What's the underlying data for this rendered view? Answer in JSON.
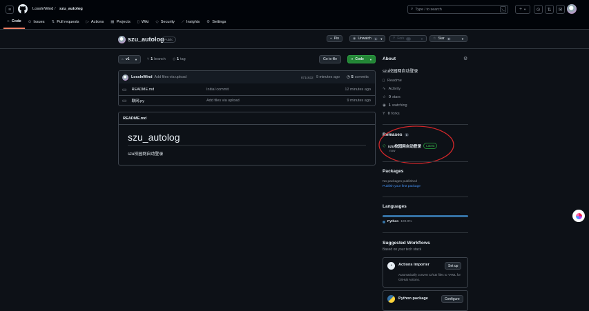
{
  "header": {
    "owner": "LossInWind",
    "separator": "/",
    "repo": "szu_autolog",
    "search_placeholder": "Type / to search",
    "plus": "+"
  },
  "nav_tabs": [
    {
      "label": "Code",
      "icon": "code-icon"
    },
    {
      "label": "Issues",
      "icon": "issue-icon"
    },
    {
      "label": "Pull requests",
      "icon": "pull-request-icon"
    },
    {
      "label": "Actions",
      "icon": "play-icon"
    },
    {
      "label": "Projects",
      "icon": "table-icon"
    },
    {
      "label": "Wiki",
      "icon": "book-icon"
    },
    {
      "label": "Security",
      "icon": "shield-icon"
    },
    {
      "label": "Insights",
      "icon": "graph-icon"
    },
    {
      "label": "Settings",
      "icon": "gear-icon"
    }
  ],
  "repo": {
    "name": "szu_autolog",
    "visibility": "Public",
    "pin": "Pin",
    "unwatch": "Unwatch",
    "watch_count": "1",
    "fork": "Fork",
    "fork_count": "0",
    "star": "Star",
    "star_count": "0"
  },
  "toolbar": {
    "branch": "v1",
    "branches_count": "1",
    "branches_label": "branch",
    "tags_count": "1",
    "tags_label": "tag",
    "go_to_file": "Go to file",
    "code": "Code"
  },
  "commit": {
    "author": "LossInWind",
    "message": "Add files via upload",
    "hash": "871c632",
    "time": "9 minutes ago",
    "count": "5",
    "count_label": "commits"
  },
  "files": [
    {
      "name": "README.md",
      "message": "Initial commit",
      "time": "12 minutes ago"
    },
    {
      "name": "联网.py",
      "message": "Add files via upload",
      "time": "9 minutes ago"
    }
  ],
  "readme": {
    "filename": "README.md",
    "heading": "szu_autolog",
    "body": "szu校园网自动登录"
  },
  "about": {
    "title": "About",
    "description": "szu校园网自动登录",
    "readme": "Readme",
    "activity": "Activity",
    "stars_count": "0",
    "stars_label": "stars",
    "watching_count": "1",
    "watching_label": "watching",
    "forks_count": "0",
    "forks_label": "forks"
  },
  "releases": {
    "title": "Releases",
    "count": "1",
    "name": "szu校园网自动登录",
    "badge": "Latest",
    "time": "now"
  },
  "packages": {
    "title": "Packages",
    "none": "No packages published",
    "publish": "Publish your first package"
  },
  "languages": {
    "title": "Languages",
    "name": "Python",
    "percent": "100.0%",
    "percent_value": 100,
    "color": "#3572A5"
  },
  "workflows": {
    "title": "Suggested Workflows",
    "subtitle": "Based on your tech stack",
    "items": [
      {
        "name": "Actions Importer",
        "button": "Set up",
        "description": "Automatically convert CI/CD files to YAML for GitHub Actions."
      },
      {
        "name": "Python package",
        "button": "Configure"
      }
    ]
  },
  "colors": {
    "accent": "#f78166",
    "green": "#238636",
    "link": "#4493f8",
    "annotation": "#d0272a"
  }
}
